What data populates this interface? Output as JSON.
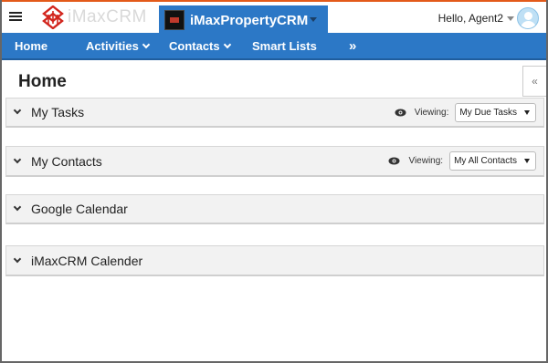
{
  "topbar": {
    "menu_icon": "hamburger-icon",
    "logo_text": "iMaxCRM",
    "app_tab_label": "iMaxPropertyCRM",
    "user_greeting": "Hello, Agent2",
    "accent_color": "#e35a1a",
    "brand_color": "#2c78c6"
  },
  "nav": {
    "items": [
      {
        "label": "Home",
        "has_dropdown": false
      },
      {
        "label": "Activities",
        "has_dropdown": true
      },
      {
        "label": "Contacts",
        "has_dropdown": true
      },
      {
        "label": "Smart Lists",
        "has_dropdown": false
      }
    ],
    "more_label": "»"
  },
  "page": {
    "title": "Home",
    "collapse_label": "«"
  },
  "panels": [
    {
      "title": "My Tasks",
      "viewing_label": "Viewing:",
      "selected": "My Due Tasks"
    },
    {
      "title": "My Contacts",
      "viewing_label": "Viewing:",
      "selected": "My All Contacts"
    },
    {
      "title": "Google Calendar"
    },
    {
      "title": "iMaxCRM Calender"
    }
  ]
}
